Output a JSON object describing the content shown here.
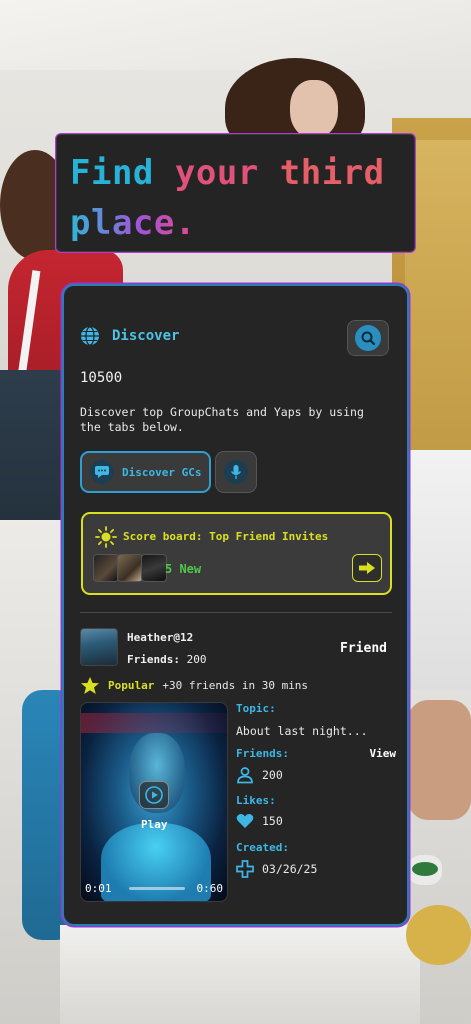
{
  "headline": {
    "line1_word1": "Find",
    "line1_word2": "your",
    "line1_word3": "third",
    "line2": "place."
  },
  "discover": {
    "title": "Discover",
    "count": "10500",
    "description": "Discover top GroupChats and Yaps by using the tabs below.",
    "tabs": [
      {
        "label": "Discover GCs",
        "icon": "chat-icon",
        "active": true
      },
      {
        "label": "",
        "icon": "microphone-icon",
        "active": false
      }
    ]
  },
  "scoreboard": {
    "title": "Score board: Top Friend Invites",
    "new_label": "5 New",
    "icon": "sun-icon"
  },
  "post": {
    "username": "Heather@12",
    "friends_label": "Friends:",
    "friends_count": "200",
    "relation": "Friend",
    "popular_label": "Popular",
    "popular_desc": "+30 friends in 30 mins",
    "video": {
      "play_label": "Play",
      "time_start": "0:01",
      "time_end": "0:60"
    },
    "topic_label": "Topic:",
    "topic_value": "About last night...",
    "meta_friends_label": "Friends:",
    "view_label": "View",
    "meta_friends_value": "200",
    "likes_label": "Likes:",
    "likes_value": "150",
    "created_label": "Created:",
    "created_value": "03/26/25"
  },
  "colors": {
    "accent_blue": "#3db7e6",
    "accent_yellow": "#d9e021",
    "accent_green": "#4fc94a",
    "card_bg": "#252525",
    "border_purple": "#8d3ad6"
  }
}
